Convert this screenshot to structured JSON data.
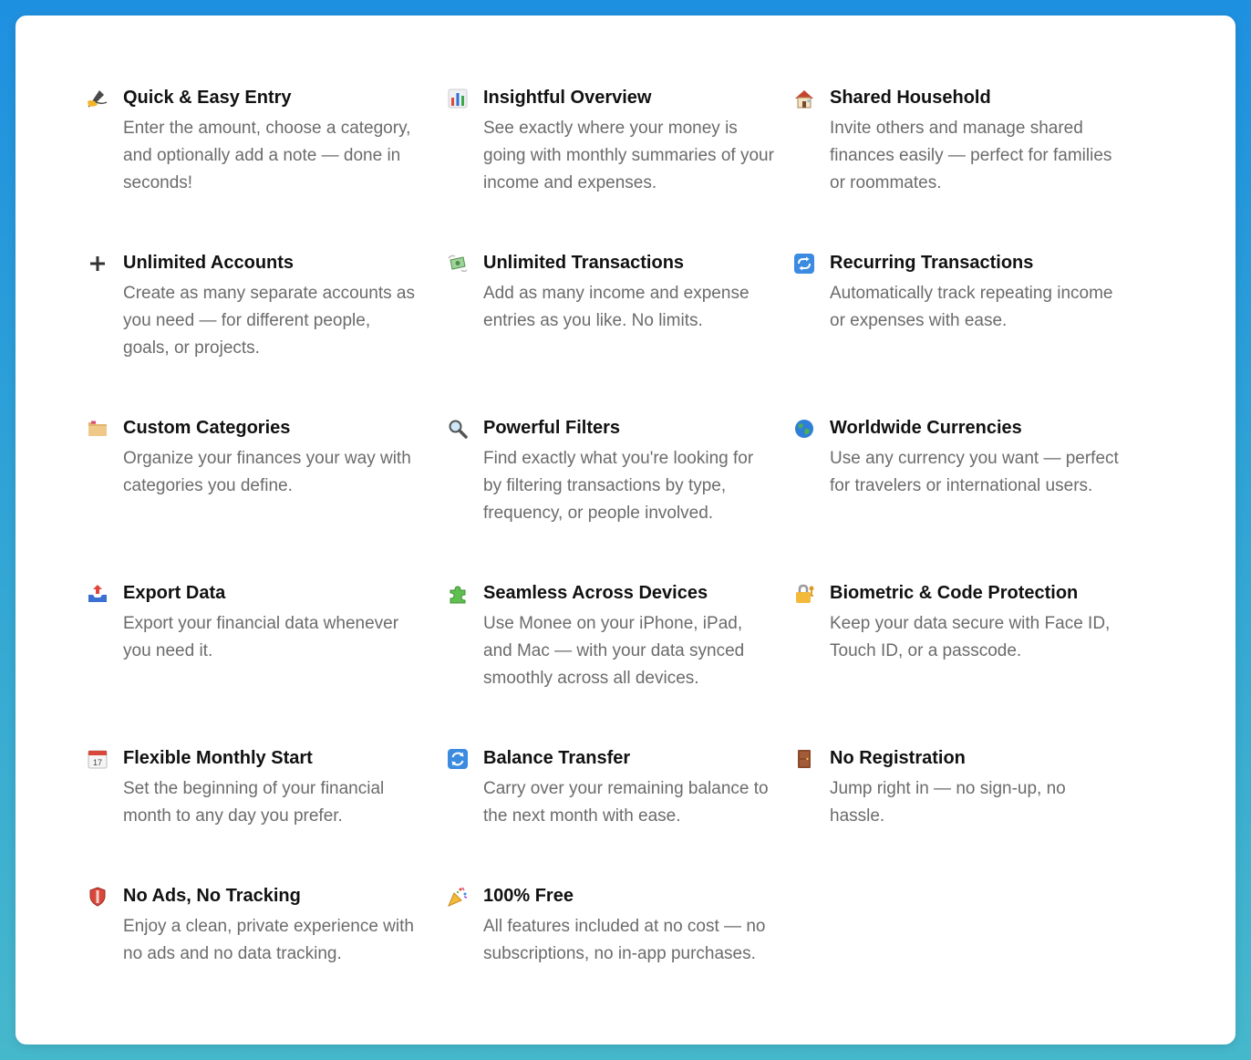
{
  "features": [
    {
      "title": "Quick & Easy Entry",
      "description": "Enter the amount, choose a category, and optionally add a note — done in seconds!",
      "icon": "writing-hand-icon"
    },
    {
      "title": "Insightful Overview",
      "description": "See exactly where your money is going with monthly summaries of your income and expenses.",
      "icon": "bar-chart-icon"
    },
    {
      "title": "Shared Household",
      "description": "Invite others and manage shared finances easily — perfect for families or roommates.",
      "icon": "house-icon"
    },
    {
      "title": "Unlimited Accounts",
      "description": "Create as many separate accounts as you need — for different people, goals, or projects.",
      "icon": "plus-icon"
    },
    {
      "title": "Unlimited Transactions",
      "description": "Add as many income and expense entries as you like. No limits.",
      "icon": "flying-money-icon"
    },
    {
      "title": "Recurring Transactions",
      "description": "Automatically track repeating income or expenses with ease.",
      "icon": "repeat-icon"
    },
    {
      "title": "Custom Categories",
      "description": "Organize your finances your way with categories you define.",
      "icon": "folder-icon"
    },
    {
      "title": "Powerful Filters",
      "description": "Find exactly what you're looking for by filtering transactions by type, frequency, or people involved.",
      "icon": "magnifier-icon"
    },
    {
      "title": "Worldwide Currencies",
      "description": "Use any currency you want — perfect for travelers or international users.",
      "icon": "globe-icon"
    },
    {
      "title": "Export Data",
      "description": "Export your financial data whenever you need it.",
      "icon": "outbox-tray-icon"
    },
    {
      "title": "Seamless Across Devices",
      "description": "Use Monee on your iPhone, iPad, and Mac — with your data synced smoothly across all devices.",
      "icon": "puzzle-icon"
    },
    {
      "title": "Biometric & Code Protection",
      "description": "Keep your data secure with Face ID, Touch ID, or a passcode.",
      "icon": "lock-key-icon"
    },
    {
      "title": "Flexible Monthly Start",
      "description": "Set the beginning of your financial month to any day you prefer.",
      "icon": "calendar-icon",
      "icon_text": "17"
    },
    {
      "title": "Balance Transfer",
      "description": "Carry over your remaining balance to the next month with ease.",
      "icon": "cycle-arrows-icon"
    },
    {
      "title": "No Registration",
      "description": "Jump right in — no sign-up, no hassle.",
      "icon": "door-icon"
    },
    {
      "title": "No Ads, No Tracking",
      "description": "Enjoy a clean, private experience with no ads and no data tracking.",
      "icon": "shield-icon"
    },
    {
      "title": "100% Free",
      "description": "All features included at no cost — no subscriptions, no in-app purchases.",
      "icon": "party-popper-icon"
    }
  ]
}
